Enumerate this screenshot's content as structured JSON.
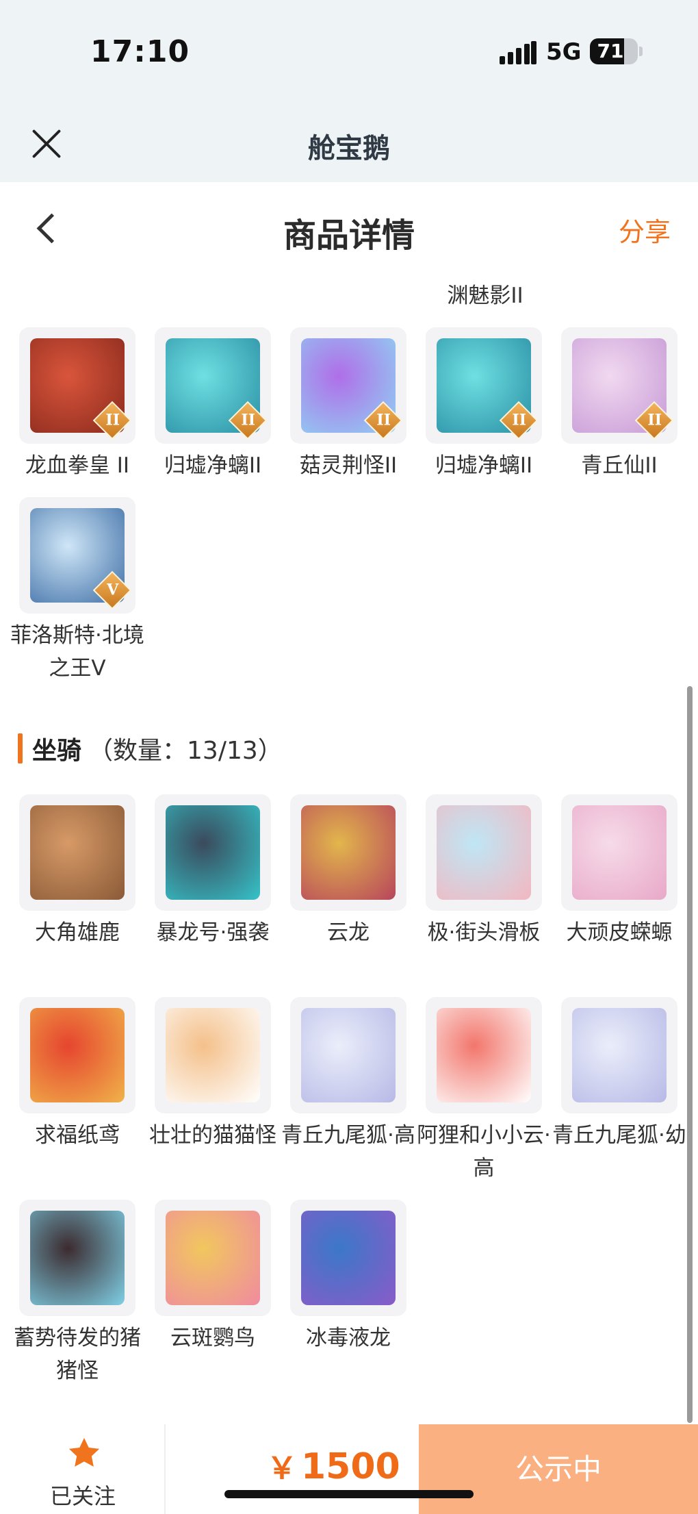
{
  "status_bar": {
    "time": "17:10",
    "network": "5G",
    "battery": "71",
    "battery_level": 0.71
  },
  "header": {
    "app_title": "舱宝鹅"
  },
  "nav": {
    "title": "商品详情",
    "share_label": "分享"
  },
  "truncated_label": "渊魅影II",
  "skins": [
    {
      "name": "龙血拳皇 II",
      "badge": "II",
      "colors": [
        "#d9553b",
        "#8a2a1d"
      ]
    },
    {
      "name": "归墟净螭II",
      "badge": "II",
      "colors": [
        "#6fe0e2",
        "#2a8fa4"
      ]
    },
    {
      "name": "菇灵荆怪II",
      "badge": "II",
      "colors": [
        "#b06ee8",
        "#8fd3f3"
      ]
    },
    {
      "name": "归墟净螭II",
      "badge": "II",
      "colors": [
        "#6fe0e2",
        "#2a8fa4"
      ]
    },
    {
      "name": "青丘仙II",
      "badge": "II",
      "colors": [
        "#f1d9f0",
        "#c79ad6"
      ]
    },
    {
      "name": "菲洛斯特·北境之王V",
      "badge": "V",
      "colors": [
        "#cfe6f7",
        "#3f6fa6"
      ]
    }
  ],
  "mounts_section": {
    "title": "坐骑",
    "count": "（数量：13/13）"
  },
  "mounts": [
    {
      "name": "大角雄鹿",
      "colors": [
        "#d79a67",
        "#8a5a37"
      ]
    },
    {
      "name": "暴龙号·强袭",
      "colors": [
        "#3a4a5c",
        "#36c3c9"
      ]
    },
    {
      "name": "云龙",
      "colors": [
        "#e2b64c",
        "#b7455c"
      ]
    },
    {
      "name": "极·街头滑板",
      "colors": [
        "#bfe6f5",
        "#f3b7c0"
      ]
    },
    {
      "name": "大顽皮蝾螈",
      "colors": [
        "#f6dbe9",
        "#e8a8c8"
      ]
    },
    {
      "name": "求福纸鸢",
      "colors": [
        "#e6452f",
        "#f0b34a"
      ]
    },
    {
      "name": "壮壮的猫猫怪",
      "colors": [
        "#f4c08a",
        "#ffffff"
      ]
    },
    {
      "name": "青丘九尾狐·高",
      "colors": [
        "#eaeefa",
        "#b7b9e6"
      ]
    },
    {
      "name": "阿狸和小小云·高",
      "colors": [
        "#f2766c",
        "#ffffff"
      ]
    },
    {
      "name": "青丘九尾狐·幼",
      "colors": [
        "#eaeefa",
        "#b7b9e6"
      ]
    },
    {
      "name": "蓄势待发的猪猪怪",
      "colors": [
        "#3c2b2f",
        "#7fd0e6"
      ]
    },
    {
      "name": "云斑鹦鸟",
      "colors": [
        "#f1c75e",
        "#f08aa0"
      ]
    },
    {
      "name": "冰毒液龙",
      "colors": [
        "#3b78c8",
        "#8a5bc9"
      ]
    }
  ],
  "bottom_bar": {
    "follow_label": "已关注",
    "currency": "￥",
    "price": "1500",
    "status_label": "公示中"
  },
  "colors": {
    "accent": "#f0741e",
    "status_button": "#fbb082",
    "header_bg": "#eef3f6"
  }
}
